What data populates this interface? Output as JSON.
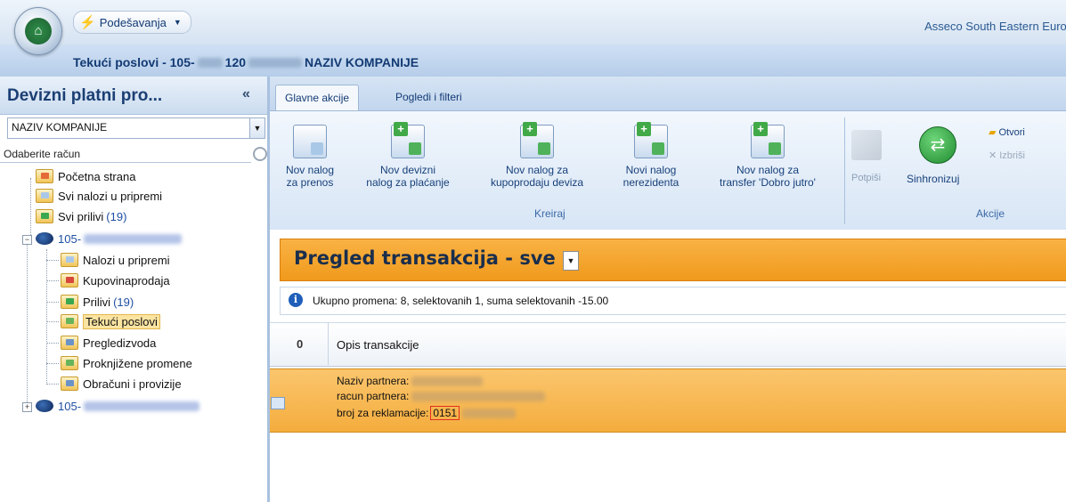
{
  "title_bar": {
    "menu_label": "Podešavanja",
    "company_brand": "Asseco South Eastern Europ"
  },
  "breadcrumb": {
    "prefix": "Tekući poslovi - 105-",
    "mid": "120",
    "company": "NAZIV KOMPANIJE"
  },
  "left_panel": {
    "title": "Devizni platni pro...",
    "collapse_glyph": "«",
    "company_select": "NAZIV KOMPANIJE",
    "account_label": "Odaberite račun",
    "tree": {
      "home": "Početna strana",
      "all_orders": "Svi nalozi u pripremi",
      "all_inflows": "Svi prilivi",
      "all_inflows_count": "(19)",
      "account1": "105-",
      "orders_prep": "Nalozi u pripremi",
      "buy_sell": "Kupovinaprodaja",
      "inflows": "Prilivi",
      "inflows_count": "(19)",
      "current": "Tekući poslovi",
      "statements": "Pregledizvoda",
      "posted": "Proknjižene promene",
      "fees": "Obračuni i provizije",
      "account2": "105-"
    }
  },
  "ribbon": {
    "tabs": [
      "Glavne akcije",
      "Pogledi i filteri"
    ],
    "kreiraj": {
      "group_label": "Kreiraj",
      "buttons": [
        {
          "line1": "Nov nalog",
          "line2": "za prenos"
        },
        {
          "line1": "Nov devizni",
          "line2": "nalog za plaćanje"
        },
        {
          "line1": "Nov nalog za",
          "line2": "kupoprodaju deviza"
        },
        {
          "line1": "Novi nalog",
          "line2": "nerezidenta"
        },
        {
          "line1": "Nov nalog za",
          "line2": "transfer 'Dobro jutro'"
        }
      ]
    },
    "akcije": {
      "group_label": "Akcije",
      "sign": "Potpiši",
      "sync": "Sinhronizuj",
      "open": "Otvori",
      "delete": "Izbriši"
    }
  },
  "view": {
    "title": "Pregled transakcija - sve",
    "info": "Ukupno promena: 8, selektovanih 1, suma selektovanih -15.00",
    "columns": {
      "attach": "0",
      "description": "Opis transakcije"
    },
    "row": {
      "partner_name_label": "Naziv partnera:",
      "partner_account_label": "racun partnera:",
      "complaint_label": "broj za reklamacije:",
      "complaint_value": "0151"
    }
  }
}
